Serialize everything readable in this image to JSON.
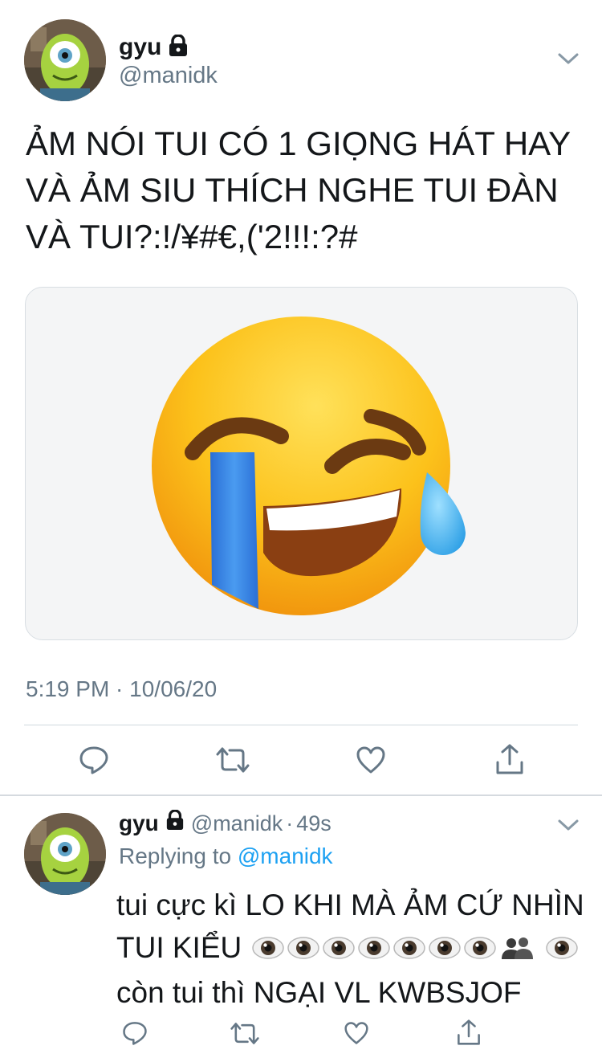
{
  "main_tweet": {
    "display_name": "gyu",
    "handle": "@manidk",
    "text_lines": [
      "ẢM NÓI TUI CÓ 1 GIỌNG HÁT HAY",
      "VÀ ẢM SIU THÍCH NGHE TUI ĐÀN",
      "VÀ TUI?:!/¥#€,('2!!!:?#"
    ],
    "timestamp": "5:19 PM · 10/06/20",
    "media_emoji": "face-with-tears-of-joy"
  },
  "reply_tweet": {
    "display_name": "gyu",
    "handle": "@manidk",
    "dot_sep": "·",
    "time": "49s",
    "replying_label": "Replying to",
    "replying_to": "@manidk",
    "text_part1": "tui cực kì LO KHI MÀ ẢM CỨ NHÌN TUI KIỂU",
    "text_part2": "còn tui thì NGẠI VL KWBSJOF"
  },
  "icons": [
    "lock-icon",
    "chevron-down-icon",
    "reply-icon",
    "retweet-icon",
    "like-icon",
    "share-icon",
    "eye-emoji",
    "busts-emoji"
  ]
}
